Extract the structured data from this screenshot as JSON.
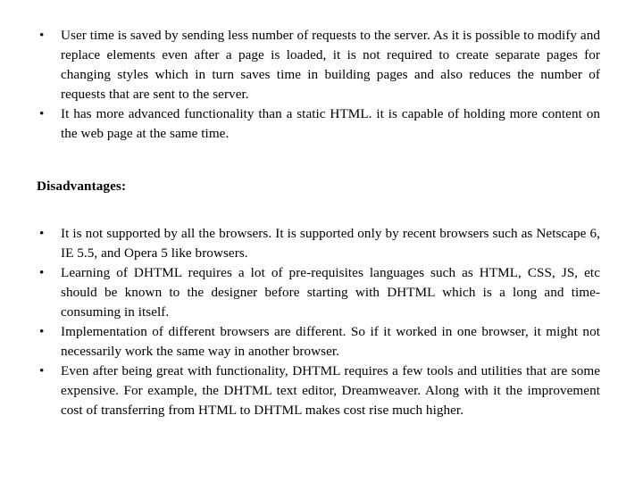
{
  "slide": {
    "background_color": "#ffffff",
    "text_color": "#000000",
    "bullet_glyph": "•"
  },
  "advantages_list": {
    "items": [
      {
        "bullet": "•",
        "text": "User time is saved by sending less number of requests to the server. As it is possible to modify and replace elements even after a page is loaded, it is not required to create separate pages for changing styles which in turn saves time in building pages and also reduces the number of requests that are sent to the server."
      },
      {
        "bullet": "•",
        "text": "It has more advanced functionality than a static HTML. it is capable of holding more content on the web page at the same time."
      }
    ]
  },
  "heading": {
    "text": "Disadvantages:"
  },
  "disadvantages_list": {
    "items": [
      {
        "bullet": "•",
        "text": "It is not supported by all the browsers. It is supported only by recent browsers such as Netscape 6, IE 5.5, and Opera 5 like browsers."
      },
      {
        "bullet": "•",
        "text": "Learning of DHTML requires a lot of pre-requisites languages such as HTML, CSS, JS, etc should be known to the designer before starting with DHTML which is a long and time-consuming in itself."
      },
      {
        "bullet": "•",
        "text": "Implementation of different browsers are different. So if it worked in one browser, it might not necessarily work the same way in another browser."
      },
      {
        "bullet": "•",
        "text": "Even after being great with functionality, DHTML requires a few tools and utilities that are some expensive. For example, the DHTML text editor, Dreamweaver. Along with it the improvement cost of transferring from HTML to DHTML makes cost rise much higher."
      }
    ]
  }
}
